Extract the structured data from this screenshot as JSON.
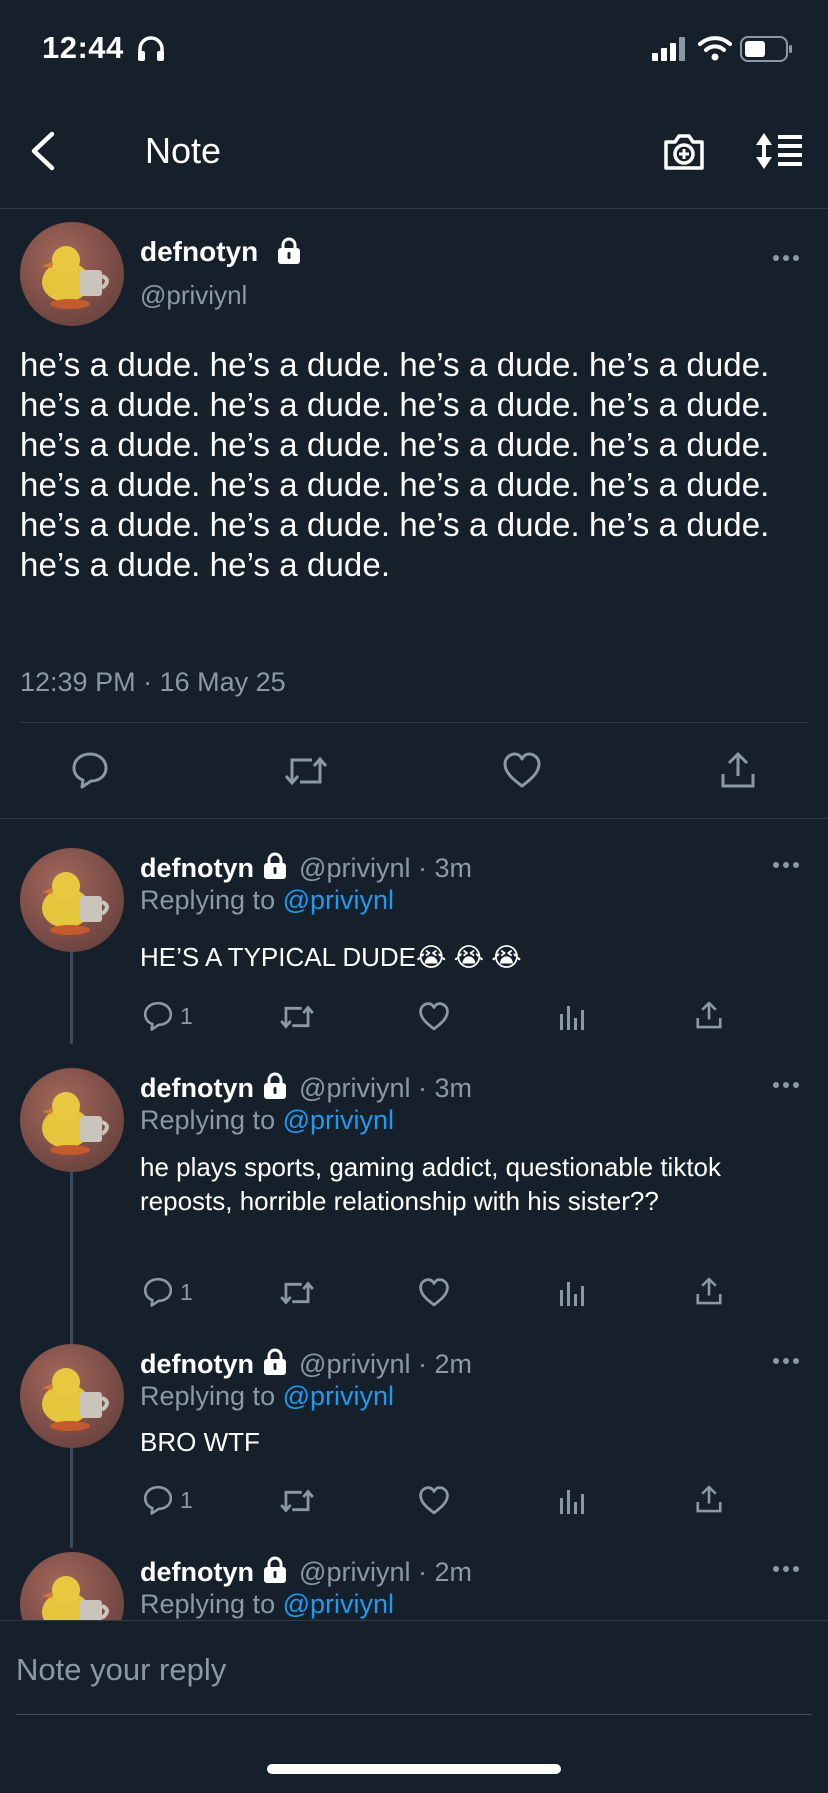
{
  "status_bar": {
    "time": "12:44"
  },
  "header": {
    "title": "Note"
  },
  "main_note": {
    "display_name": "defnotyn",
    "handle": "@priviynl",
    "text": "he’s a dude. he’s a dude. he’s a dude. he’s a dude. he’s a dude. he’s a dude. he’s a dude. he’s a dude. he’s a dude. he’s a dude. he’s a dude. he’s a dude. he’s a dude. he’s a dude. he’s a dude. he’s a dude. he’s a dude. he’s a dude. he’s a dude. he’s a dude. he’s a dude. he’s a dude.",
    "timestamp": "12:39 PM · 16 May 25"
  },
  "replies": [
    {
      "display_name": "defnotyn",
      "handle": "@priviynl",
      "age": "3m",
      "replying_label": "Replying to",
      "replying_to": "@priviynl",
      "text": "HE’S A TYPICAL DUDE😭 😭 😭",
      "reply_count": "1"
    },
    {
      "display_name": "defnotyn",
      "handle": "@priviynl",
      "age": "3m",
      "replying_label": "Replying to",
      "replying_to": "@priviynl",
      "text": "he plays sports, gaming addict, questionable tiktok reposts, horrible relationship with his sister??",
      "reply_count": "1"
    },
    {
      "display_name": "defnotyn",
      "handle": "@priviynl",
      "age": "2m",
      "replying_label": "Replying to",
      "replying_to": "@priviynl",
      "text": "BRO WTF",
      "reply_count": "1"
    },
    {
      "display_name": "defnotyn",
      "handle": "@priviynl",
      "age": "2m",
      "replying_label": "Replying to",
      "replying_to": "@priviynl",
      "text": "",
      "reply_count": ""
    }
  ],
  "compose": {
    "placeholder": "Note your reply"
  },
  "colors": {
    "background": "#15202b",
    "accent": "#1d9bf0",
    "muted": "#8b98a5",
    "divider": "#2f3b47"
  },
  "icons": [
    "back-arrow-icon",
    "camera-icon",
    "sort-icon",
    "lock-icon",
    "more-icon",
    "reply-icon",
    "retweet-icon",
    "like-icon",
    "analytics-icon",
    "share-icon",
    "headphones-icon",
    "signal-icon",
    "wifi-icon",
    "battery-icon"
  ]
}
